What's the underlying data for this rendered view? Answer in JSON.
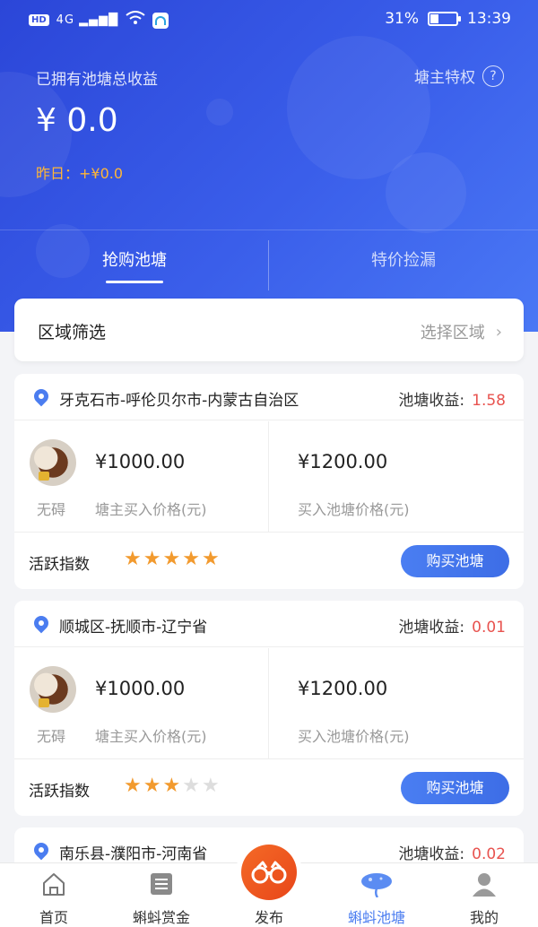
{
  "status_bar": {
    "hd": "HD",
    "network": "4G",
    "battery": "31%",
    "time": "13:39"
  },
  "header": {
    "earn_label": "已拥有池塘总收益",
    "privilege_label": "塘主特权",
    "help_icon": "?",
    "amount": "¥  0.0",
    "yesterday": "昨日：+¥0.0"
  },
  "tabs": [
    {
      "label": "抢购池塘"
    },
    {
      "label": "特价捡漏"
    }
  ],
  "filter": {
    "title": "区域筛选",
    "select_label": "选择区域",
    "chevron": "›"
  },
  "card_labels": {
    "earnings": "池塘收益:",
    "owner_price_label": "塘主买入价格(元)",
    "buy_price_label": "买入池塘价格(元)",
    "activity_label": "活跃指数",
    "buy_button": "购买池塘"
  },
  "cards": [
    {
      "location": "牙克石市-呼伦贝尔市-内蒙古自治区",
      "earnings": "1.58",
      "owner_name": "无碍",
      "owner_price": "¥1000.00",
      "buy_price": "¥1200.00",
      "activity_stars": 5
    },
    {
      "location": "顺城区-抚顺市-辽宁省",
      "earnings": "0.01",
      "owner_name": "无碍",
      "owner_price": "¥1000.00",
      "buy_price": "¥1200.00",
      "activity_stars": 3
    },
    {
      "location": "南乐县-濮阳市-河南省",
      "earnings": "0.02"
    }
  ],
  "tabbar": [
    {
      "label": "首页",
      "icon": "home-icon"
    },
    {
      "label": "蝌蚪赏金",
      "icon": "list-icon"
    },
    {
      "label": "发布",
      "icon": "binoculars-icon"
    },
    {
      "label": "蝌蚪池塘",
      "icon": "lotus-icon"
    },
    {
      "label": "我的",
      "icon": "user-icon"
    }
  ],
  "colors": {
    "accent": "#4b7df0",
    "earnings": "#e8534f",
    "yesterday": "#ffb637",
    "star": "#f29a2e",
    "publish": "#f0591f"
  }
}
